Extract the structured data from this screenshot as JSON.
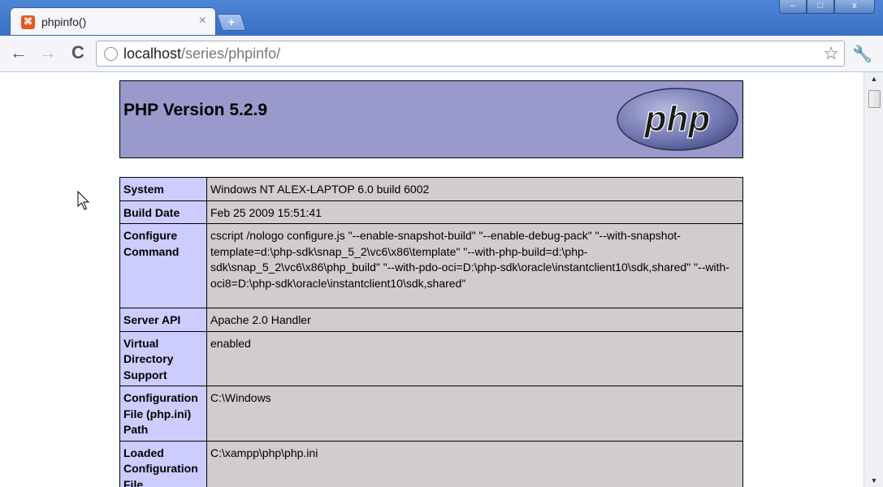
{
  "browser": {
    "tab": {
      "favicon_glyph": "⌘",
      "title": "phpinfo()",
      "close_glyph": "×"
    },
    "new_tab_glyph": "+",
    "window_controls": {
      "minimize": "–",
      "maximize": "□",
      "close": "x"
    },
    "toolbar": {
      "back_glyph": "←",
      "forward_glyph": "→",
      "reload_glyph": "C",
      "url_host": "localhost",
      "url_path": "/series/phpinfo/",
      "bookmark_glyph": "☆",
      "menu_glyph": "🔧"
    }
  },
  "page": {
    "heading": "PHP Version 5.2.9",
    "logo_text": "php",
    "colors": {
      "header_bg": "#9999cc",
      "key_cell_bg": "#ccccff",
      "value_cell_bg": "#d0cccf"
    },
    "rows": [
      {
        "key": "System",
        "value": "Windows NT ALEX-LAPTOP 6.0 build 6002"
      },
      {
        "key": "Build Date",
        "value": "Feb 25 2009 15:51:41"
      },
      {
        "key": "Configure Command",
        "value": "cscript /nologo configure.js \"--enable-snapshot-build\" \"--enable-debug-pack\" \"--with-snapshot-template=d:\\php-sdk\\snap_5_2\\vc6\\x86\\template\" \"--with-php-build=d:\\php-sdk\\snap_5_2\\vc6\\x86\\php_build\" \"--with-pdo-oci=D:\\php-sdk\\oracle\\instantclient10\\sdk,shared\" \"--with-oci8=D:\\php-sdk\\oracle\\instantclient10\\sdk,shared\""
      },
      {
        "key": "Server API",
        "value": "Apache 2.0 Handler"
      },
      {
        "key": "Virtual Directory Support",
        "value": "enabled"
      },
      {
        "key": "Configuration File (php.ini) Path",
        "value": "C:\\Windows"
      },
      {
        "key": "Loaded Configuration File",
        "value": "C:\\xampp\\php\\php.ini"
      }
    ]
  },
  "scrollbar": {
    "up_glyph": "▲",
    "down_glyph": "▼"
  }
}
